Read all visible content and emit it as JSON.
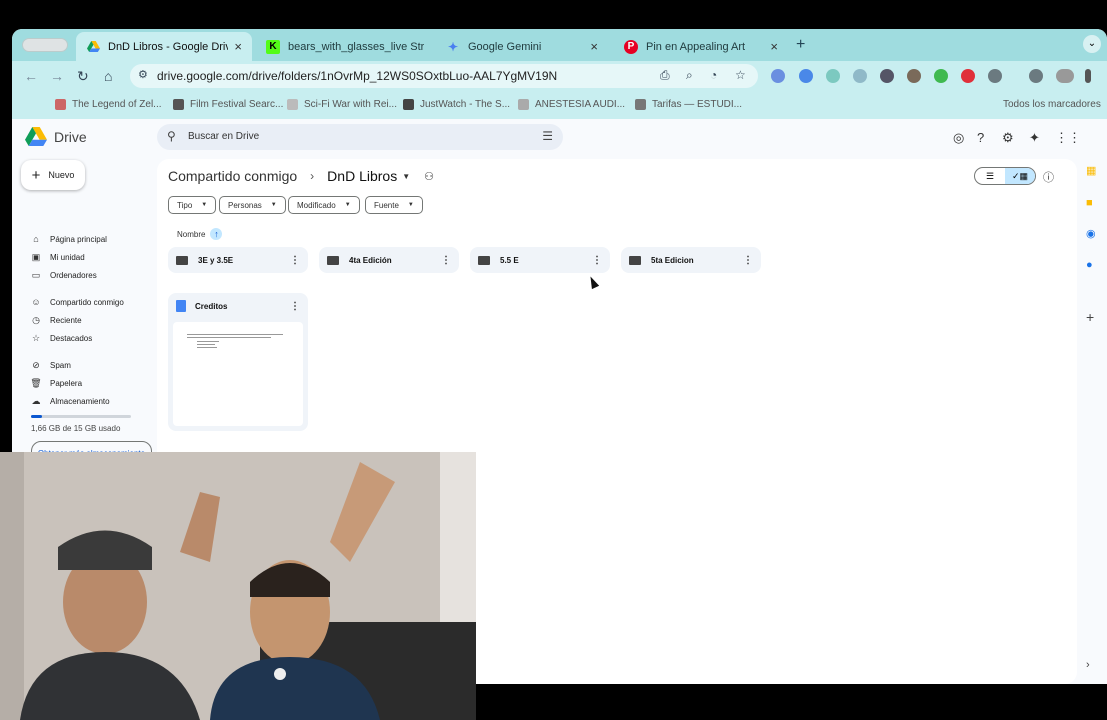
{
  "tabs": [
    {
      "title": "DnD Libros - Google Drive",
      "icon": "google-drive-icon",
      "active": true
    },
    {
      "title": "bears_with_glasses_live Stre",
      "icon": "kick-icon"
    },
    {
      "title": "Google Gemini",
      "icon": "gemini-icon"
    },
    {
      "title": "Pin en Appealing Art",
      "icon": "pinterest-icon"
    }
  ],
  "url": "drive.google.com/drive/folders/1nOvrMp_12WS0SOxtbLuo-AAL7YgMV19N",
  "bookmarks": [
    "The Legend of Zel...",
    "Film Festival Searc...",
    "Sci-Fi War with Rei...",
    "JustWatch - The S...",
    "ANESTESIA AUDI...",
    "Tarifas — ESTUDI..."
  ],
  "bookmarks_all": "Todos los marcadores",
  "drive": {
    "app_name": "Drive",
    "search_placeholder": "Buscar en Drive",
    "new_label": "Nuevo",
    "nav": [
      {
        "label": "Página principal",
        "icon": "home-icon"
      },
      {
        "label": "Mi unidad",
        "icon": "my-drive-icon"
      },
      {
        "label": "Ordenadores",
        "icon": "computers-icon"
      },
      {
        "label": "Compartido conmigo",
        "icon": "shared-icon"
      },
      {
        "label": "Reciente",
        "icon": "clock-icon"
      },
      {
        "label": "Destacados",
        "icon": "star-icon"
      },
      {
        "label": "Spam",
        "icon": "spam-icon"
      },
      {
        "label": "Papelera",
        "icon": "trash-icon"
      },
      {
        "label": "Almacenamiento",
        "icon": "cloud-icon"
      }
    ],
    "storage_text": "1,66 GB de 15 GB usado",
    "storage_fraction": 0.11,
    "get_more": "Obtener más almacenamiento",
    "breadcrumb": {
      "parent": "Compartido conmigo",
      "separator": "›",
      "current": "DnD Libros"
    },
    "filters": [
      "Tipo",
      "Personas",
      "Modificado",
      "Fuente"
    ],
    "sort_label": "Nombre",
    "folders": [
      "3E y 3.5E",
      "4ta Edición",
      "5.5 E",
      "5ta Edicion"
    ],
    "files": [
      {
        "name": "Creditos",
        "type": "google-doc"
      }
    ]
  }
}
